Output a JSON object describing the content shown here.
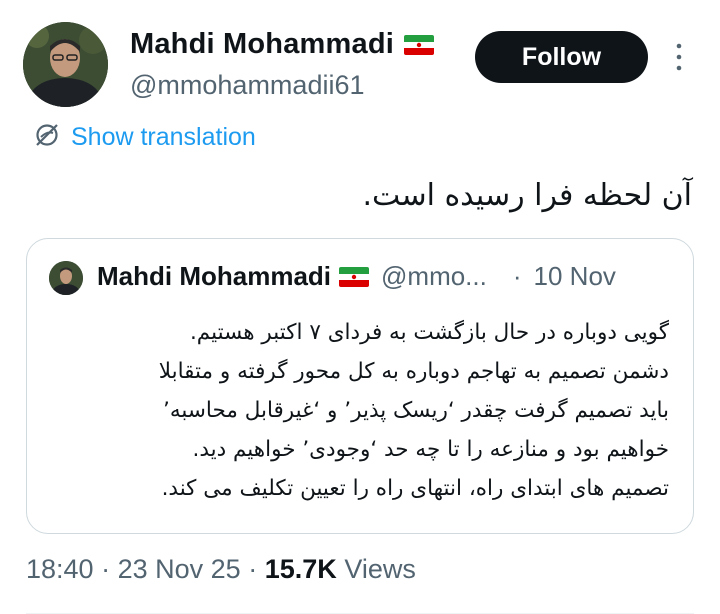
{
  "author": {
    "display_name": "Mahdi Mohammadi",
    "handle": "@mmohammadii61"
  },
  "follow_label": "Follow",
  "translation_label": "Show translation",
  "tweet_text": "آن لحظه فرا رسیده است.",
  "quoted": {
    "display_name": "Mahdi Mohammadi",
    "handle": "@mmo...",
    "separator": "·",
    "date": "10 Nov",
    "lines": [
      "گویی دوباره در حال بازگشت به فردای ۷ اکتبر هستیم.",
      "دشمن تصمیم به تهاجم دوباره به کل محور گرفته و متقابلا",
      "باید تصمیم گرفت چقدر ‘ریسک پذیر’ و ‘غیرقابل محاسبه’",
      "خواهیم بود و منازعه را تا چه حد ‘وجودی’ خواهیم دید.",
      "تصمیم های ابتدای راه، انتهای راه را تعیین تکلیف می کند."
    ]
  },
  "meta": {
    "time": "18:40",
    "sep1": "·",
    "date": "23 Nov 25",
    "sep2": "·",
    "views_count": "15.7K",
    "views_label": "Views"
  },
  "colors": {
    "accent": "#1d9bf0",
    "secondary_text": "#536471",
    "border": "#cfd9de",
    "button_bg": "#0f1419"
  },
  "icons": {
    "flag": "iran-flag-icon",
    "translate": "translate-icon",
    "more": "more-vertical-icon"
  }
}
